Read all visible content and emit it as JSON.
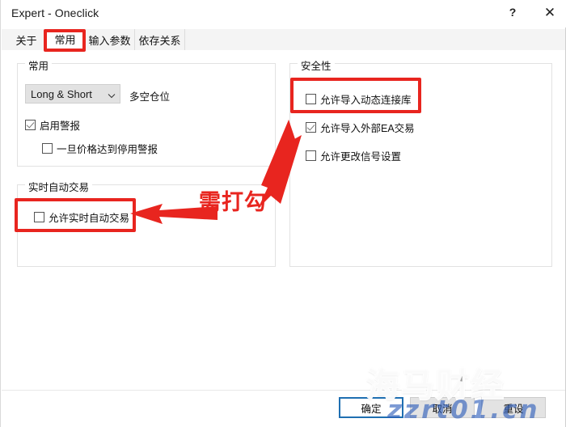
{
  "window": {
    "title": "Expert - Oneclick",
    "help_label": "?",
    "close_label": "✕"
  },
  "tabs": [
    {
      "label": "关于",
      "active": false
    },
    {
      "label": "常用",
      "active": true
    },
    {
      "label": "输入参数",
      "active": false
    },
    {
      "label": "依存关系",
      "active": false
    }
  ],
  "groups": {
    "common": {
      "title": "常用",
      "combo": {
        "value": "Long & Short",
        "caret": "chevron-down-icon",
        "side_label": "多空仓位"
      },
      "checkboxes": [
        {
          "label": "启用警报",
          "checked": true
        },
        {
          "label": "一旦价格达到停用警报",
          "checked": false
        }
      ]
    },
    "live_trading": {
      "title": "实时自动交易",
      "checkboxes": [
        {
          "label": "允许实时自动交易",
          "checked": false
        }
      ]
    },
    "security": {
      "title": "安全性",
      "checkboxes": [
        {
          "label": "允许导入动态连接库",
          "checked": false
        },
        {
          "label": "允许导入外部EA交易",
          "checked": true
        },
        {
          "label": "允许更改信号设置",
          "checked": false
        }
      ]
    }
  },
  "annotations": {
    "callout_text": "需打勾",
    "color": "#e8251f",
    "highlight_targets": [
      "tab-常用",
      "允许导入动态连接库",
      "允许实时自动交易"
    ]
  },
  "footer": {
    "ok_label": "确定",
    "cancel_label": "取消",
    "reset_label": "重设"
  },
  "watermark": {
    "main": "海马财经",
    "sub": "zzrt01.cn"
  }
}
